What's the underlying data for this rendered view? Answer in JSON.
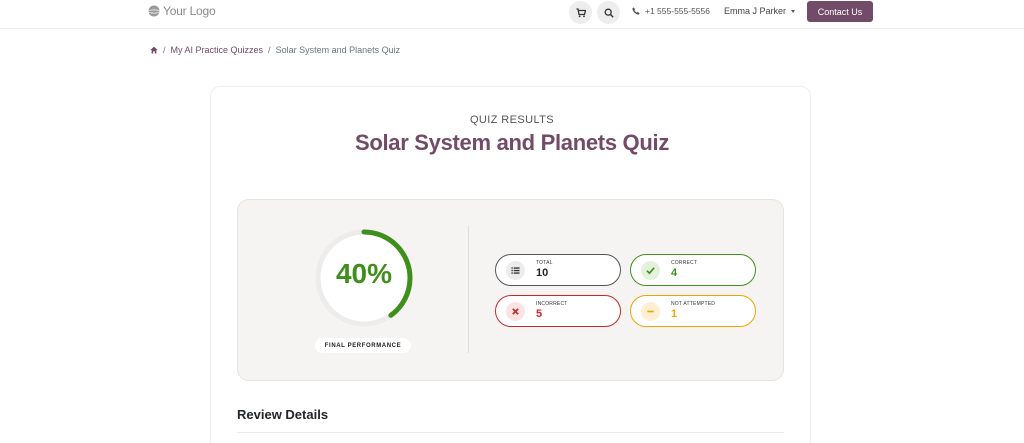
{
  "header": {
    "logo_text": "Your Logo",
    "cart_icon": "cart-icon",
    "search_icon": "search-icon",
    "phone": "+1 555-555-5556",
    "user_name": "Emma J Parker",
    "contact_label": "Contact Us",
    "accent": "#714b67"
  },
  "breadcrumb": {
    "home_icon": "home-icon",
    "items": [
      "My AI Practice Quizzes",
      "Solar System and Planets Quiz"
    ]
  },
  "result": {
    "eyebrow": "QUIZ RESULTS",
    "title": "Solar System and Planets Quiz",
    "percent_text": "40%",
    "percent_value": 0.4,
    "ring_color": "#3f8f1c",
    "final_label": "FINAL PERFORMANCE",
    "stats": [
      {
        "label": "TOTAL",
        "value": "10",
        "icon": "list-icon",
        "color": "#212529"
      },
      {
        "label": "CORRECT",
        "value": "4",
        "icon": "check-icon",
        "color": "#3f8f1c"
      },
      {
        "label": "INCORRECT",
        "value": "5",
        "icon": "x-icon",
        "color": "#c62828"
      },
      {
        "label": "NOT ATTEMPTED",
        "value": "1",
        "icon": "minus-icon",
        "color": "#f0a400"
      }
    ]
  },
  "review": {
    "heading": "Review Details"
  }
}
